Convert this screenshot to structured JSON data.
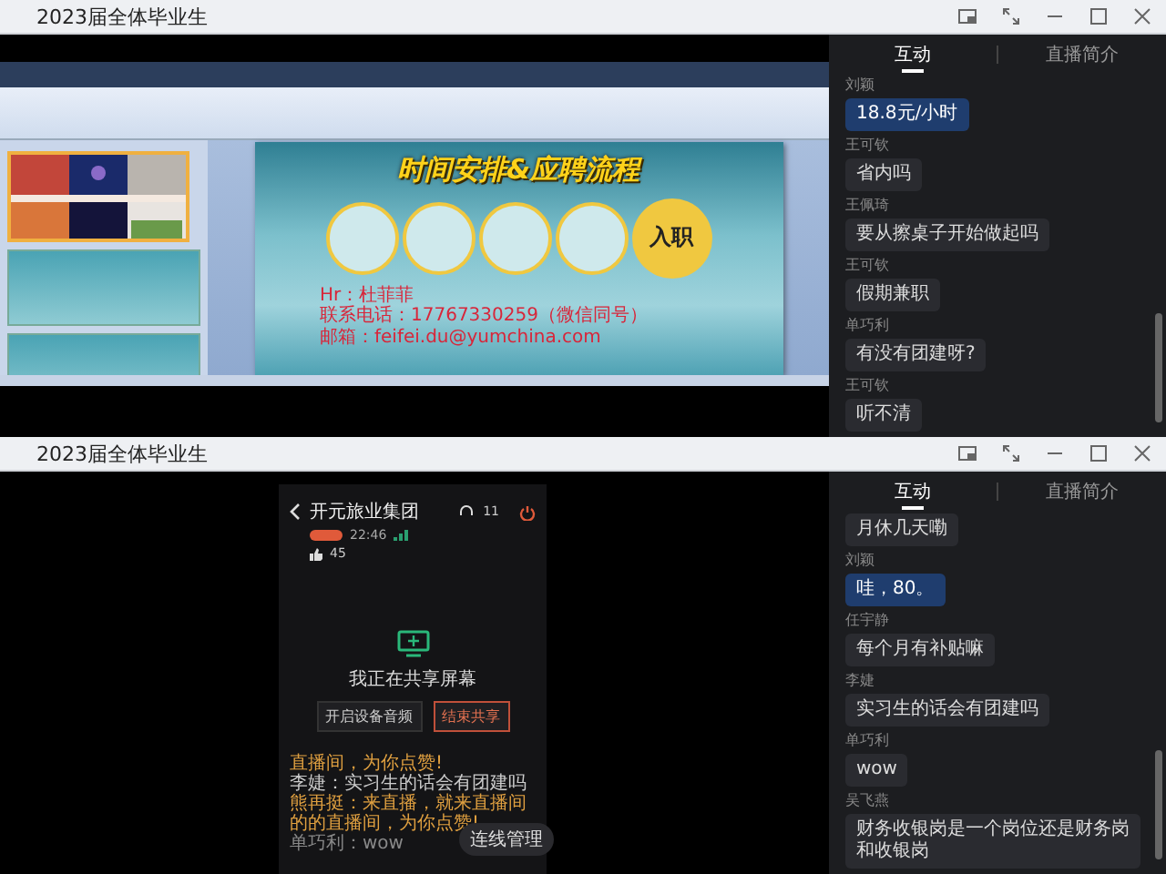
{
  "windows": [
    {
      "title": "2023届全体毕业生",
      "tabs": [
        {
          "label": "互动",
          "selected": true
        },
        {
          "label": "直播简介",
          "selected": false
        }
      ],
      "messages": [
        {
          "user": "刘颖",
          "text": "18.8元/小时",
          "highlighted": true
        },
        {
          "user": "王可钦",
          "text": "省内吗",
          "highlighted": false
        },
        {
          "user": "王佩琦",
          "text": "要从擦桌子开始做起吗",
          "highlighted": false
        },
        {
          "user": "王可钦",
          "text": "假期兼职",
          "highlighted": false
        },
        {
          "user": "单巧利",
          "text": "有没有团建呀?",
          "highlighted": false
        },
        {
          "user": "王可钦",
          "text": "听不清",
          "highlighted": false
        }
      ],
      "stage": {
        "kind": "slides",
        "slide_title": "时间安排&应聘流程",
        "final_step": "入职",
        "contact": [
          "Hr：杜菲菲",
          "联系电话：17767330259（微信同号）",
          "邮箱：feifei.du@yumchina.com"
        ]
      }
    },
    {
      "title": "2023届全体毕业生",
      "tabs": [
        {
          "label": "互动",
          "selected": true
        },
        {
          "label": "直播简介",
          "selected": false
        }
      ],
      "messages": [
        {
          "text": "月休几天嘞",
          "highlighted": false
        },
        {
          "user": "刘颖",
          "text": "哇，80。",
          "highlighted": true
        },
        {
          "user": "任宇静",
          "text": "每个月有补贴嘛",
          "highlighted": false
        },
        {
          "user": "李婕",
          "text": "实习生的话会有团建吗",
          "highlighted": false
        },
        {
          "user": "单巧利",
          "text": "wow",
          "highlighted": false
        },
        {
          "user": "吴飞燕",
          "text": "财务收银岗是一个岗位还是财务岗和收银岗",
          "highlighted": false
        }
      ],
      "stage": {
        "kind": "phone",
        "host": "开元旅业集团",
        "time": "22:46",
        "likes": "45",
        "viewers": "11",
        "share_status": "我正在共享屏幕",
        "buttons": [
          {
            "label": "开启设备音频",
            "kind": "normal"
          },
          {
            "label": "结束共享",
            "kind": "danger"
          }
        ],
        "comments": [
          {
            "text": "直播间，为你点赞!",
            "kind": "system"
          },
          {
            "text": "李婕：实习生的话会有团建吗",
            "kind": "user"
          },
          {
            "text": "熊再挺：来直播，就来直播间的的直播间，为你点赞!",
            "kind": "system"
          },
          {
            "text": "单巧利：wow",
            "kind": "muted"
          }
        ],
        "link_button": "连线管理"
      }
    }
  ]
}
